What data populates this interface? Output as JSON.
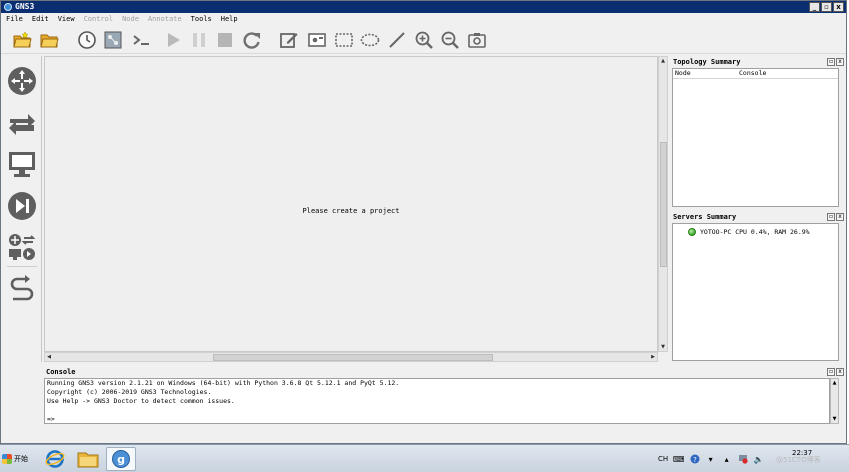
{
  "window": {
    "title": "GNS3"
  },
  "menu": [
    {
      "label": "File",
      "enabled": true
    },
    {
      "label": "Edit",
      "enabled": true
    },
    {
      "label": "View",
      "enabled": true
    },
    {
      "label": "Control",
      "enabled": false
    },
    {
      "label": "Node",
      "enabled": false
    },
    {
      "label": "Annotate",
      "enabled": false
    },
    {
      "label": "Tools",
      "enabled": true
    },
    {
      "label": "Help",
      "enabled": true
    }
  ],
  "toolbar_icons": [
    "new-project-icon",
    "open-project-icon",
    "snapshot-icon",
    "show-interface-labels-icon",
    "console-all-icon",
    "start-all-icon",
    "suspend-all-icon",
    "stop-all-icon",
    "reload-all-icon",
    "add-note-icon",
    "insert-picture-icon",
    "draw-rectangle-icon",
    "draw-ellipse-icon",
    "draw-line-icon",
    "zoom-in-icon",
    "zoom-out-icon",
    "screenshot-icon"
  ],
  "device_icons": [
    "routers-icon",
    "switches-icon",
    "end-devices-icon",
    "security-devices-icon",
    "all-devices-icon",
    "add-link-icon"
  ],
  "canvas": {
    "message": "Please create a project"
  },
  "topology_summary": {
    "title": "Topology Summary",
    "columns": [
      "Node",
      "Console"
    ]
  },
  "servers_summary": {
    "title": "Servers Summary",
    "servers": [
      {
        "text": "YOTOO-PC CPU 0.4%, RAM 26.9%",
        "status": "running"
      }
    ]
  },
  "console": {
    "title": "Console",
    "lines": [
      "Running GNS3 version 2.1.21 on Windows (64-bit) with Python 3.6.8 Qt 5.12.1 and PyQt 5.12.",
      "Copyright (c) 2006-2019 GNS3 Technologies.",
      "Use Help -> GNS3 Doctor to detect common issues.",
      "",
      "=>"
    ]
  },
  "taskbar": {
    "start_label": "开始",
    "language": "CH",
    "clock": "22:37",
    "watermark": "@51CTO博客"
  },
  "colors": {
    "titlebar": "#0a2d6e",
    "canvas_bg": "#efefef",
    "server_status": "#3aa82a"
  }
}
